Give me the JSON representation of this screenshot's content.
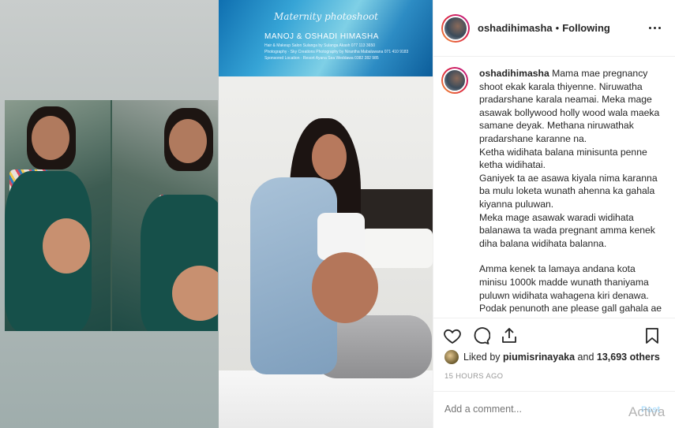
{
  "post": {
    "username": "oshadihimasha",
    "separator": "•",
    "follow_status": "Following",
    "caption_paragraphs": [
      "Mama mae pregnancy shoot ekak karala thiyenne. Niruwatha pradarshane karala neamai. Meka mage asawak bollywood holly wood wala maeka samane deyak. Methana niruwathak pradarshane karanne na.",
      "Ketha widihata balana minisunta penne ketha widihatai.",
      "Ganiyek ta ae asawa kiyala nima karanna ba mulu loketa wunath ahenna ka gahala kiyanna puluwan.",
      "Meka mage asawak waradi widihata balanawa ta wada pregnant amma kenek diha balana widihata balanna.",
      "",
      "Amma kenek ta lamaya andana kota minisu 1000k madde wunath thaniyama puluwn widihata wahagena kiri denawa. Podak penunoth ane please gall gahala ae amma wa"
    ],
    "liked_by_prefix": "Liked by",
    "liked_by_user": "piumisrinayaka",
    "liked_by_and": "and",
    "likes_others": "13,693 others",
    "timestamp": "15 HOURS AGO",
    "comment_placeholder": "Add a comment...",
    "post_button": "Post"
  },
  "media": {
    "banner_script": "Maternity photoshoot",
    "banner_title": "MANOJ & OSHADI HIMASHA",
    "banner_lines": [
      "Hair & Makeup Salon Sulanga by Sulanga Akash 077 113 3650",
      "Photography · Sky Creations Photography by Nirantha Mabaluwana 071 410 9183",
      "Sponsored Location · Resort Ayana Sea Weddawa 0382 282 985"
    ]
  },
  "overlay": {
    "watermark": "Activa"
  }
}
